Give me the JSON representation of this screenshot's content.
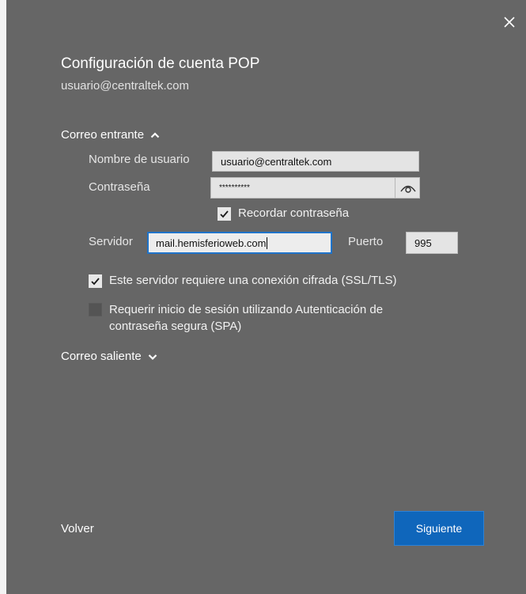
{
  "dialog": {
    "title": "Configuración de cuenta POP",
    "account_email": "usuario@centraltek.com"
  },
  "incoming": {
    "header": "Correo entrante",
    "username_label": "Nombre de usuario",
    "username_value": "usuario@centraltek.com",
    "password_label": "Contraseña",
    "password_value": "**********",
    "remember_label": "Recordar contraseña",
    "remember_checked": true,
    "server_label": "Servidor",
    "server_value": "mail.hemisferioweb.com",
    "port_label": "Puerto",
    "port_value": "995",
    "ssl_label": "Este servidor requiere una conexión cifrada (SSL/TLS)",
    "ssl_checked": true,
    "spa_label_line1": "Requerir inicio de sesión utilizando Autenticación de",
    "spa_label_line2": "contraseña segura (SPA)",
    "spa_checked": false
  },
  "outgoing": {
    "header": "Correo saliente"
  },
  "footer": {
    "back_label": "Volver",
    "next_label": "Siguiente"
  },
  "colors": {
    "dialog_bg": "#666666",
    "accent": "#0f66bb",
    "focus_border": "#1f73c9"
  }
}
